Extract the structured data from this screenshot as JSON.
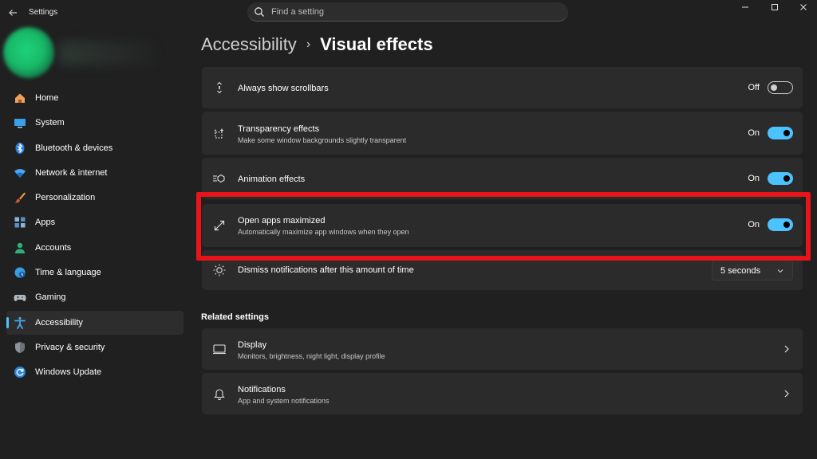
{
  "window": {
    "title": "Settings",
    "search_placeholder": "Find a setting"
  },
  "sidebar": {
    "items": [
      {
        "label": "Home",
        "icon": "home-icon"
      },
      {
        "label": "System",
        "icon": "monitor-icon"
      },
      {
        "label": "Bluetooth & devices",
        "icon": "bluetooth-icon"
      },
      {
        "label": "Network & internet",
        "icon": "wifi-icon"
      },
      {
        "label": "Personalization",
        "icon": "brush-icon"
      },
      {
        "label": "Apps",
        "icon": "apps-icon"
      },
      {
        "label": "Accounts",
        "icon": "person-icon"
      },
      {
        "label": "Time & language",
        "icon": "globe-clock-icon"
      },
      {
        "label": "Gaming",
        "icon": "controller-icon"
      },
      {
        "label": "Accessibility",
        "icon": "accessibility-icon",
        "active": true
      },
      {
        "label": "Privacy & security",
        "icon": "shield-icon"
      },
      {
        "label": "Windows Update",
        "icon": "refresh-icon"
      }
    ]
  },
  "breadcrumb": {
    "parent": "Accessibility",
    "separator": "›",
    "current": "Visual effects"
  },
  "settings": [
    {
      "title": "Always show scrollbars",
      "subtitle": "",
      "state": "Off",
      "icon": "scrollbar-icon"
    },
    {
      "title": "Transparency effects",
      "subtitle": "Make some window backgrounds slightly transparent",
      "state": "On",
      "icon": "transparency-icon"
    },
    {
      "title": "Animation effects",
      "subtitle": "",
      "state": "On",
      "icon": "animation-icon"
    },
    {
      "title": "Open apps maximized",
      "subtitle": "Automatically maximize app windows when they open",
      "state": "On",
      "icon": "maximize-icon"
    },
    {
      "title": "Dismiss notifications after this amount of time",
      "subtitle": "",
      "value": "5 seconds",
      "icon": "sun-icon"
    }
  ],
  "related": {
    "title": "Related settings",
    "items": [
      {
        "title": "Display",
        "subtitle": "Monitors, brightness, night light, display profile",
        "icon": "display-icon"
      },
      {
        "title": "Notifications",
        "subtitle": "App and system notifications",
        "icon": "bell-icon"
      }
    ]
  },
  "colors": {
    "background": "#202020",
    "card": "#2b2b2b",
    "accent": "#4cc2ff",
    "highlight": "#e8141a"
  }
}
